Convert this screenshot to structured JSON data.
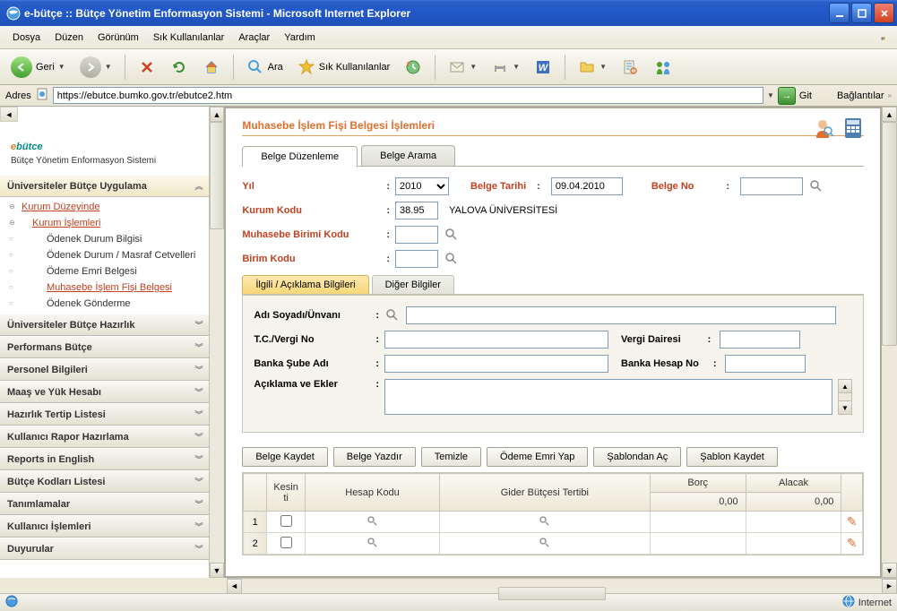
{
  "window": {
    "title": "e-bütçe :: Bütçe Yönetim Enformasyon Sistemi - Microsoft Internet Explorer"
  },
  "menu": {
    "items": [
      "Dosya",
      "Düzen",
      "Görünüm",
      "Sık Kullanılanlar",
      "Araçlar",
      "Yardım"
    ]
  },
  "toolbar": {
    "back": "Geri",
    "search": "Ara",
    "favorites": "Sık Kullanılanlar"
  },
  "address": {
    "label": "Adres",
    "url": "https://ebutce.bumko.gov.tr/ebutce2.htm",
    "go": "Git",
    "links": "Bağlantılar"
  },
  "logo": {
    "brand": "ebütce",
    "subtitle": "Bütçe Yönetim Enformasyon Sistemi"
  },
  "sidebar": {
    "active_header": "Üniversiteler Bütçe Uygulama",
    "tree": {
      "kurum_duzeyinde": "Kurum Düzeyinde",
      "kurum_islemleri": "Kurum İşlemleri",
      "odenek_durum": "Ödenek Durum Bilgisi",
      "odenek_masraf": "Ödenek Durum / Masraf Cetvelleri",
      "odeme_emri": "Ödeme Emri Belgesi",
      "muhasebe_fisi": "Muhasebe İşlem Fişi Belgesi",
      "odenek_gonderme": "Ödenek Gönderme"
    },
    "headers": [
      "Üniversiteler Bütçe Hazırlık",
      "Performans Bütçe",
      "Personel Bilgileri",
      "Maaş ve Yük Hesabı",
      "Hazırlık Tertip Listesi",
      "Kullanıcı Rapor Hazırlama",
      "Reports in English",
      "Bütçe Kodları Listesi",
      "Tanımlamalar",
      "Kullanıcı İşlemleri",
      "Duyurular"
    ]
  },
  "page": {
    "title": "Muhasebe İşlem Fişi Belgesi İşlemleri",
    "tabs": {
      "edit": "Belge Düzenleme",
      "search": "Belge Arama"
    },
    "form": {
      "yil_label": "Yıl",
      "yil_value": "2010",
      "belge_tarihi_label": "Belge Tarihi",
      "belge_tarihi_value": "09.04.2010",
      "belge_no_label": "Belge No",
      "kurum_kodu_label": "Kurum Kodu",
      "kurum_kodu_value": "38.95",
      "kurum_kodu_name": "YALOVA ÜNİVERSİTESİ",
      "muhasebe_birimi_label": "Muhasebe Birimi Kodu",
      "birim_kodu_label": "Birim Kodu"
    },
    "subtabs": {
      "ilgili": "İlgili / Açıklama Bilgileri",
      "diger": "Diğer Bilgiler"
    },
    "subform": {
      "adi_soyadi": "Adı Soyadı/Ünvanı",
      "tc_vergi": "T.C./Vergi No",
      "vergi_dairesi": "Vergi Dairesi",
      "banka_sube": "Banka Şube Adı",
      "banka_hesap": "Banka Hesap No",
      "aciklama": "Açıklama ve Ekler"
    },
    "actions": {
      "kaydet": "Belge Kaydet",
      "yazdir": "Belge Yazdır",
      "temizle": "Temizle",
      "odeme": "Ödeme Emri Yap",
      "sablon_ac": "Şablondan Aç",
      "sablon_kaydet": "Şablon Kaydet"
    },
    "grid": {
      "cols": {
        "kesinti": "Kesin ti",
        "hesap": "Hesap Kodu",
        "gider": "Gider Bütçesi Tertibi",
        "borc": "Borç",
        "alacak": "Alacak"
      },
      "borc_total": "0,00",
      "alacak_total": "0,00",
      "rows": [
        "1",
        "2"
      ]
    }
  },
  "status": {
    "zone": "Internet"
  }
}
